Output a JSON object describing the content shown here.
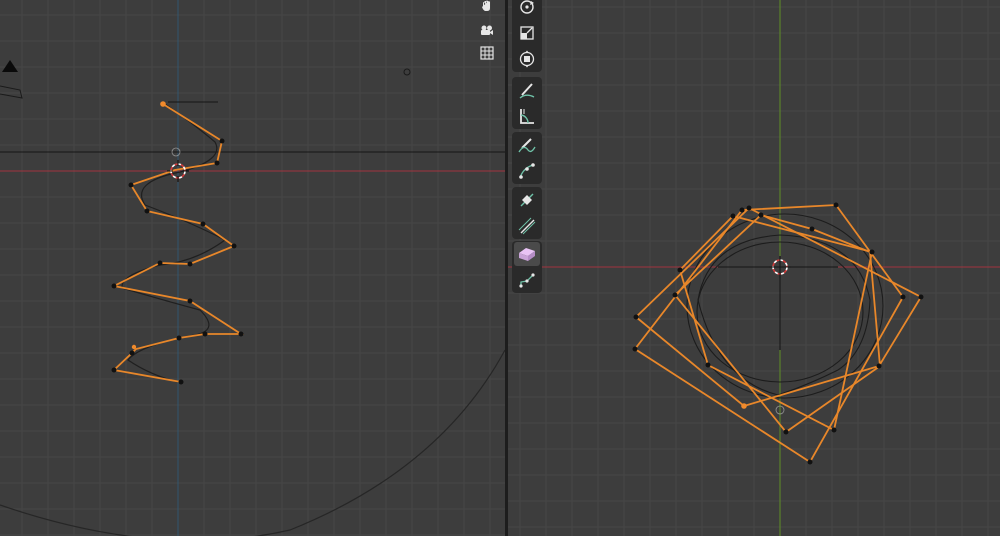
{
  "app": "3D Viewport",
  "colors": {
    "background": "#3d3d3d",
    "grid_minor": "#474747",
    "grid_major": "#4e4e4e",
    "x_axis": "#a1343f",
    "y_axis": "#5f8f25",
    "z_axis": "#31556e",
    "selected_edge": "#e8872a",
    "vertex": "#111111",
    "active_vertex": "#f08a2c",
    "toolbar_bg": "#2a2a2a"
  },
  "left_viewport": {
    "view": "side-orthographic",
    "nav_icons": [
      "hand-pan-icon",
      "camera-view-icon",
      "ortho-grid-icon"
    ]
  },
  "right_viewport": {
    "view": "top-orthographic",
    "toolbar_groups": [
      [
        "rotate-tool-icon",
        "scale-tool-icon",
        "transform-tool-icon"
      ],
      [
        "annotate-tool-icon",
        "measure-tool-icon"
      ],
      [
        "draw-curve-tool-icon",
        "pen-tool-icon"
      ],
      [
        "tilt-tool-icon",
        "radius-tool-icon"
      ],
      [
        "extrude-tool-icon",
        "randomize-tool-icon"
      ]
    ],
    "active_tool": "extrude-tool-icon"
  }
}
